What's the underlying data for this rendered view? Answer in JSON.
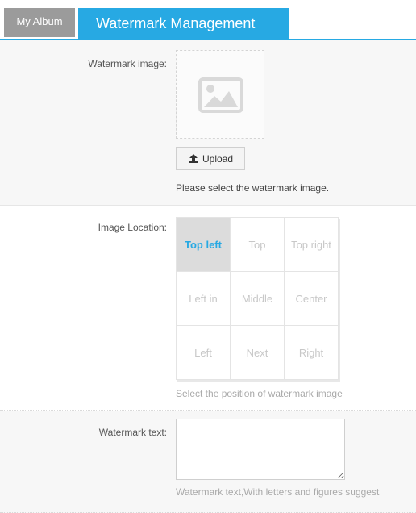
{
  "tabs": {
    "album_label": "My Album",
    "watermark_label": "Watermark Management"
  },
  "image_section": {
    "label": "Watermark image:",
    "placeholder_icon": "image-placeholder-icon",
    "upload_icon": "upload-icon",
    "upload_label": "Upload",
    "hint": "Please select the watermark image."
  },
  "location_section": {
    "label": "Image Location:",
    "positions": [
      "Top left",
      "Top",
      "Top right",
      "Left in",
      "Middle",
      "Center",
      "Left",
      "Next",
      "Right"
    ],
    "selected": "Top left",
    "hint": "Select the position of watermark image"
  },
  "text_section": {
    "label": "Watermark text:",
    "value": "",
    "hint": "Watermark text,With letters and figures suggest"
  },
  "colors": {
    "accent": "#27a9e3",
    "inactive_tab": "#9b9b9b",
    "selected_cell": "#dcdcdc"
  }
}
